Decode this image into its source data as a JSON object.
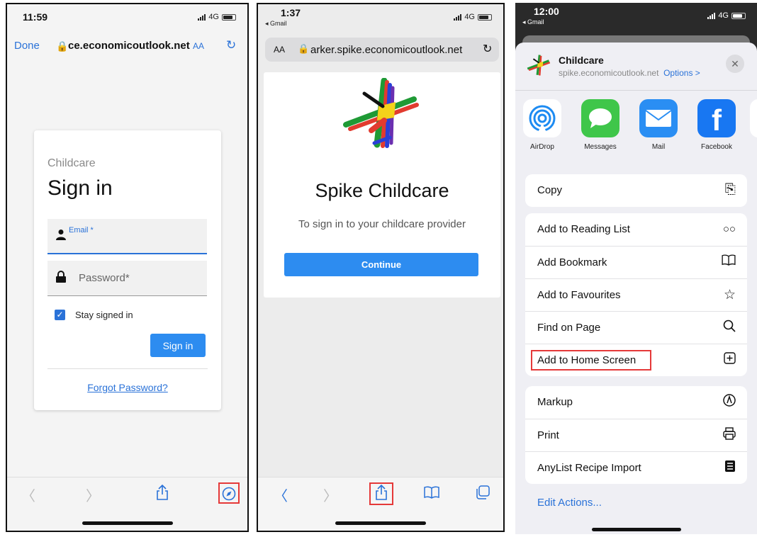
{
  "phone1": {
    "status": {
      "time": "11:59",
      "network": "4G"
    },
    "nav": {
      "done": "Done",
      "url": "ce.economicoutlook.net",
      "text_size": "AA"
    },
    "login": {
      "brand": "Childcare",
      "title": "Sign in",
      "email_label": "Email *",
      "password_label": "Password*",
      "stay_signed_in": "Stay signed in",
      "signin_button": "Sign in",
      "forgot_password": "Forgot Password?"
    },
    "toolbar_icons": [
      "back-icon",
      "forward-icon",
      "share-icon",
      "compass-icon"
    ]
  },
  "phone2": {
    "status": {
      "time": "1:37",
      "back_app": "◂ Gmail",
      "network": "4G"
    },
    "nav": {
      "text_size": "AA",
      "url": "arker.spike.economicoutlook.net"
    },
    "page": {
      "name": "Spike Childcare",
      "description": "To sign in to your childcare provider",
      "continue_button": "Continue"
    },
    "toolbar_icons": [
      "back-icon",
      "forward-icon",
      "share-icon",
      "bookmarks-icon",
      "tabs-icon"
    ]
  },
  "phone3": {
    "status": {
      "time": "12:00",
      "back_app": "◂ Gmail",
      "network": "4G"
    },
    "sheet": {
      "title": "Childcare",
      "url": "spike.economicoutlook.net",
      "options": "Options >",
      "apps": [
        {
          "label": "AirDrop",
          "icon": "airdrop-icon",
          "color": "#ffffff"
        },
        {
          "label": "Messages",
          "icon": "messages-icon",
          "color": "#3fc64a"
        },
        {
          "label": "Mail",
          "icon": "mail-icon",
          "color": "#2a8ef3"
        },
        {
          "label": "Facebook",
          "icon": "facebook-icon",
          "color": "#1877f2"
        }
      ],
      "group1": [
        {
          "label": "Copy",
          "icon": "copy-icon"
        }
      ],
      "group2": [
        {
          "label": "Add to Reading List",
          "icon": "glasses-icon"
        },
        {
          "label": "Add Bookmark",
          "icon": "book-icon"
        },
        {
          "label": "Add to Favourites",
          "icon": "star-icon"
        },
        {
          "label": "Find on Page",
          "icon": "search-icon"
        },
        {
          "label": "Add to Home Screen",
          "icon": "plus-square-icon"
        }
      ],
      "group3": [
        {
          "label": "Markup",
          "icon": "markup-icon"
        },
        {
          "label": "Print",
          "icon": "printer-icon"
        },
        {
          "label": "AnyList Recipe Import",
          "icon": "anylist-icon"
        }
      ],
      "edit_actions": "Edit Actions..."
    }
  },
  "colors": {
    "accent": "#2a72d8",
    "button": "#2d8cf0",
    "highlight": "#e53939"
  }
}
